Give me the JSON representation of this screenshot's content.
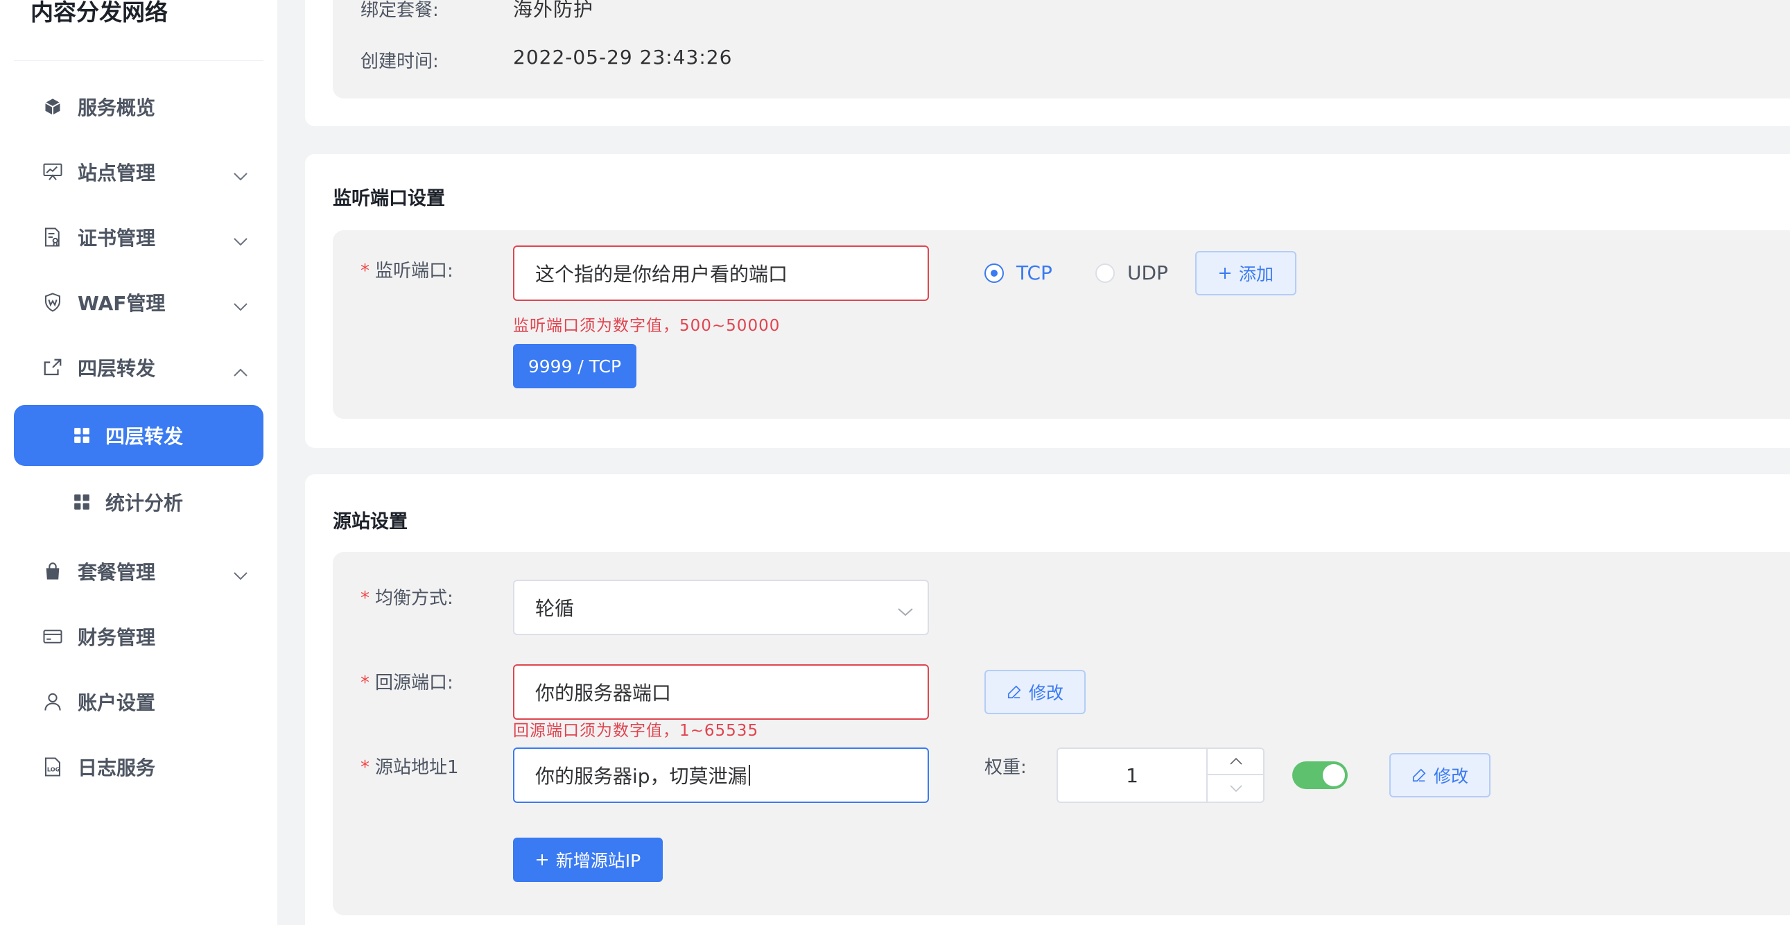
{
  "sidebar": {
    "brand": "内容分发网络",
    "items": [
      {
        "label": "服务概览",
        "icon": "cube-icon"
      },
      {
        "label": "站点管理",
        "icon": "monitor-chart-icon"
      },
      {
        "label": "证书管理",
        "icon": "certificate-icon"
      },
      {
        "label": "WAF管理",
        "icon": "waf-shield-icon"
      },
      {
        "label": "四层转发",
        "icon": "share-forward-icon"
      },
      {
        "label": "四层转发",
        "icon": "grid-icon"
      },
      {
        "label": "统计分析",
        "icon": "grid-icon"
      },
      {
        "label": "套餐管理",
        "icon": "bag-icon"
      },
      {
        "label": "财务管理",
        "icon": "card-icon"
      },
      {
        "label": "账户设置",
        "icon": "user-icon"
      },
      {
        "label": "日志服务",
        "icon": "log-file-icon"
      }
    ]
  },
  "info": {
    "bound_plan_label": "绑定套餐:",
    "bound_plan_value": "海外防护",
    "created_label": "创建时间:",
    "created_value": "2022-05-29 23:43:26"
  },
  "listen": {
    "title": "监听端口设置",
    "port_label": "监听端口:",
    "port_value": "这个指的是你给用户看的端口",
    "error": "监听端口须为数字值，500~50000",
    "protocol_tcp": "TCP",
    "protocol_udp": "UDP",
    "add_label": "添加",
    "tag_label": "9999 / TCP"
  },
  "origin": {
    "title": "源站设置",
    "balance_label": "均衡方式:",
    "balance_value": "轮循",
    "back_port_label": "回源端口:",
    "back_port_value": "你的服务器端口",
    "back_port_error": "回源端口须为数字值，1~65535",
    "modify_label": "修改",
    "address_label": "源站地址1",
    "address_value": "你的服务器ip，切莫泄漏",
    "weight_label": "权重:",
    "weight_value": "1",
    "add_ip_label": "新增源站IP"
  },
  "colors": {
    "accent": "#3a7af2",
    "error": "#e0454f",
    "switch_on": "#5ec16d"
  }
}
